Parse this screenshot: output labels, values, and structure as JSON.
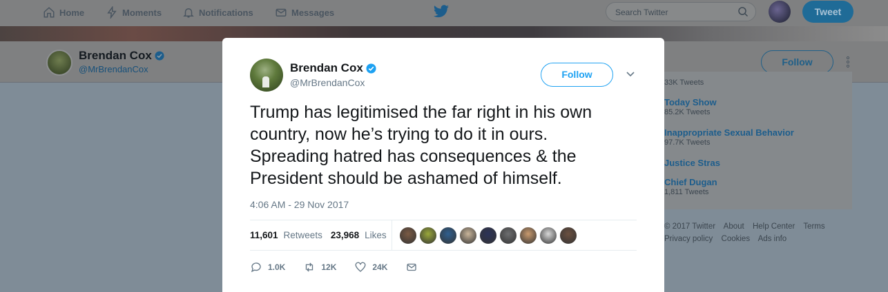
{
  "topnav": {
    "items": [
      {
        "label": "Home",
        "icon": "home-icon"
      },
      {
        "label": "Moments",
        "icon": "lightning-icon"
      },
      {
        "label": "Notifications",
        "icon": "bell-icon"
      },
      {
        "label": "Messages",
        "icon": "envelope-icon"
      }
    ],
    "search_placeholder": "Search Twitter",
    "tweet_button": "Tweet"
  },
  "profile": {
    "name": "Brendan Cox",
    "handle": "@MrBrendanCox",
    "follow_label": "Follow"
  },
  "trends": {
    "partial_count": "33K Tweets",
    "items": [
      {
        "title": "Today Show",
        "count": "85.2K Tweets"
      },
      {
        "title": "Inappropriate Sexual Behavior",
        "count": "97.7K Tweets"
      },
      {
        "title": "Justice Stras",
        "count": ""
      },
      {
        "title": "Chief Dugan",
        "count": "1,811 Tweets"
      }
    ]
  },
  "footer": {
    "row1": [
      "© 2017 Twitter",
      "About",
      "Help Center",
      "Terms"
    ],
    "row2": [
      "Privacy policy",
      "Cookies",
      "Ads info"
    ]
  },
  "tweet": {
    "name": "Brendan Cox",
    "handle": "@MrBrendanCox",
    "follow_label": "Follow",
    "text": "Trump has legitimised the far right in his own\ncountry, now he’s trying to do it in ours.\nSpreading hatred has consequences & the\nPresident should be ashamed of himself.",
    "timestamp": "4:06 AM - 29 Nov 2017",
    "retweets_count": "11,601",
    "retweets_label": "Retweets",
    "likes_count": "23,968",
    "likes_label": "Likes",
    "liker_faces": [
      "#7a5a44",
      "#9aa83a",
      "#2f5f8f",
      "#c9b59a",
      "#2c3358",
      "#6d6e70",
      "#c99a6e",
      "#d8d8d8",
      "#6b5040"
    ],
    "actions": {
      "reply": "1.0K",
      "retweet": "12K",
      "like": "24K"
    }
  },
  "colors": {
    "accent": "#1da1f2",
    "text": "#14171a",
    "muted": "#657786"
  }
}
